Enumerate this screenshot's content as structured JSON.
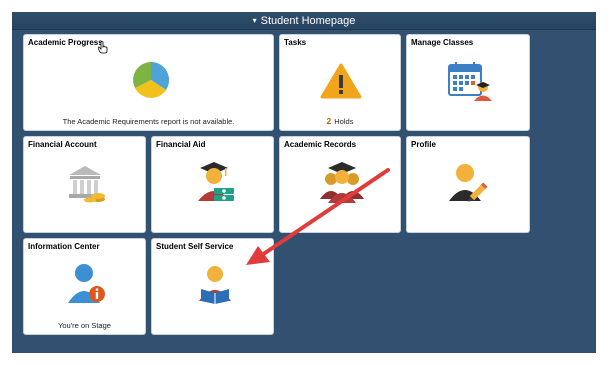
{
  "header": {
    "title": "Student Homepage",
    "caret": "▾"
  },
  "tiles": [
    {
      "title": "Academic Progress",
      "footer": "The Academic Requirements report is not available.",
      "icon": "pie-chart-icon"
    },
    {
      "title": "Tasks",
      "count": "2",
      "footer": "Holds",
      "icon": "warning-icon"
    },
    {
      "title": "Manage Classes",
      "icon": "calendar-student-icon"
    },
    {
      "title": "Financial Account",
      "icon": "bank-coins-icon"
    },
    {
      "title": "Financial Aid",
      "icon": "graduate-money-icon"
    },
    {
      "title": "Academic Records",
      "icon": "graduates-icon"
    },
    {
      "title": "Profile",
      "icon": "person-pencil-icon"
    },
    {
      "title": "Information Center",
      "footer": "You're on Stage",
      "icon": "person-info-icon"
    },
    {
      "title": "Student Self Service",
      "icon": "student-reading-icon"
    }
  ],
  "colors": {
    "background": "#32506f",
    "pie_blue": "#4fa3d9",
    "pie_yellow": "#f2c21b",
    "pie_green": "#7cb342",
    "warning": "#f2a41b",
    "accent_arrow": "#e03c3c",
    "count_orange": "#b8650f"
  }
}
